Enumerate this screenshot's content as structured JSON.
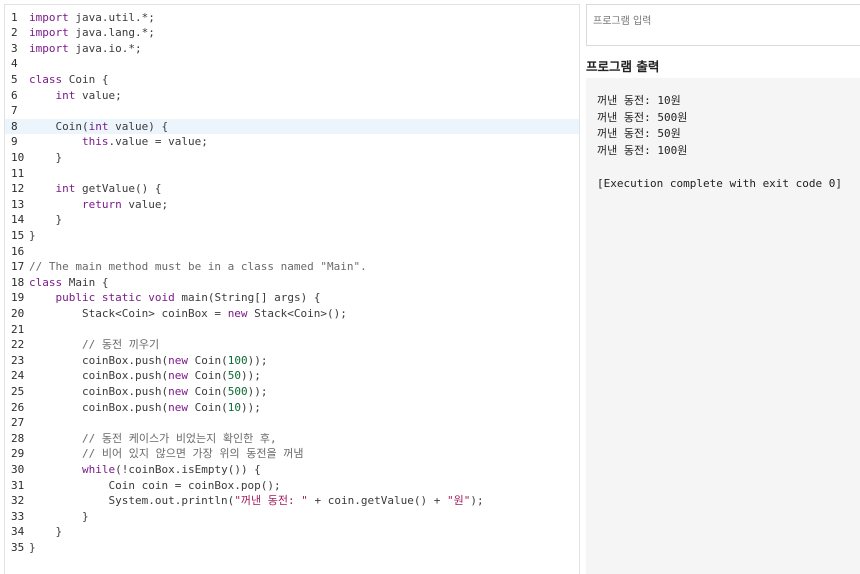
{
  "editor": {
    "active_line": 8,
    "lines": [
      [
        [
          "kw",
          "import"
        ],
        [
          "t",
          " java.util.*;"
        ]
      ],
      [
        [
          "kw",
          "import"
        ],
        [
          "t",
          " java.lang.*;"
        ]
      ],
      [
        [
          "kw",
          "import"
        ],
        [
          "t",
          " java.io.*;"
        ]
      ],
      [],
      [
        [
          "kw",
          "class"
        ],
        [
          "t",
          " Coin {"
        ]
      ],
      [
        [
          "t",
          "    "
        ],
        [
          "ty",
          "int"
        ],
        [
          "t",
          " value;"
        ]
      ],
      [],
      [
        [
          "t",
          "    Coin("
        ],
        [
          "ty",
          "int"
        ],
        [
          "t",
          " value) {"
        ]
      ],
      [
        [
          "t",
          "        "
        ],
        [
          "kw",
          "this"
        ],
        [
          "t",
          ".value = value;"
        ]
      ],
      [
        [
          "t",
          "    }"
        ]
      ],
      [],
      [
        [
          "t",
          "    "
        ],
        [
          "ty",
          "int"
        ],
        [
          "t",
          " getValue() {"
        ]
      ],
      [
        [
          "t",
          "        "
        ],
        [
          "kw",
          "return"
        ],
        [
          "t",
          " value;"
        ]
      ],
      [
        [
          "t",
          "    }"
        ]
      ],
      [
        [
          "t",
          "}"
        ]
      ],
      [],
      [
        [
          "cmt",
          "// The main method must be in a class named \"Main\"."
        ]
      ],
      [
        [
          "kw",
          "class"
        ],
        [
          "t",
          " Main {"
        ]
      ],
      [
        [
          "t",
          "    "
        ],
        [
          "kw",
          "public"
        ],
        [
          "t",
          " "
        ],
        [
          "kw",
          "static"
        ],
        [
          "t",
          " "
        ],
        [
          "ty",
          "void"
        ],
        [
          "t",
          " main(String[] args) {"
        ]
      ],
      [
        [
          "t",
          "        Stack<Coin> coinBox = "
        ],
        [
          "kw",
          "new"
        ],
        [
          "t",
          " Stack<Coin>();"
        ]
      ],
      [],
      [
        [
          "t",
          "        "
        ],
        [
          "cmt",
          "// 동전 끼우기"
        ]
      ],
      [
        [
          "t",
          "        coinBox.push("
        ],
        [
          "kw",
          "new"
        ],
        [
          "t",
          " Coin("
        ],
        [
          "lit",
          "100"
        ],
        [
          "t",
          "));"
        ]
      ],
      [
        [
          "t",
          "        coinBox.push("
        ],
        [
          "kw",
          "new"
        ],
        [
          "t",
          " Coin("
        ],
        [
          "lit",
          "50"
        ],
        [
          "t",
          "));"
        ]
      ],
      [
        [
          "t",
          "        coinBox.push("
        ],
        [
          "kw",
          "new"
        ],
        [
          "t",
          " Coin("
        ],
        [
          "lit",
          "500"
        ],
        [
          "t",
          "));"
        ]
      ],
      [
        [
          "t",
          "        coinBox.push("
        ],
        [
          "kw",
          "new"
        ],
        [
          "t",
          " Coin("
        ],
        [
          "lit",
          "10"
        ],
        [
          "t",
          "));"
        ]
      ],
      [],
      [
        [
          "t",
          "        "
        ],
        [
          "cmt",
          "// 동전 케이스가 비었는지 확인한 후,"
        ]
      ],
      [
        [
          "t",
          "        "
        ],
        [
          "cmt",
          "// 비어 있지 않으면 가장 위의 동전을 꺼냄"
        ]
      ],
      [
        [
          "t",
          "        "
        ],
        [
          "kw",
          "while"
        ],
        [
          "t",
          "(!coinBox.isEmpty()) {"
        ]
      ],
      [
        [
          "t",
          "            Coin coin = coinBox.pop();"
        ]
      ],
      [
        [
          "t",
          "            System.out.println("
        ],
        [
          "str",
          "\"꺼낸 동전: \""
        ],
        [
          "t",
          " + coin.getValue() + "
        ],
        [
          "str",
          "\"원\""
        ],
        [
          "t",
          ");"
        ]
      ],
      [
        [
          "t",
          "        }"
        ]
      ],
      [
        [
          "t",
          "    }"
        ]
      ],
      [
        [
          "t",
          "}"
        ]
      ]
    ]
  },
  "input": {
    "placeholder": "프로그램 입력"
  },
  "output": {
    "title": "프로그램 출력",
    "lines": [
      "꺼낸 동전: 10원",
      "꺼낸 동전: 500원",
      "꺼낸 동전: 50원",
      "꺼낸 동전: 100원",
      "",
      "[Execution complete with exit code 0]"
    ]
  },
  "colors": {
    "keyword": "#7a1b8a",
    "number": "#0b6b33",
    "string": "#a11d5e",
    "comment": "#6a6a6a",
    "active_line_bg": "#ecf5fc",
    "output_bg": "#f5f5f5"
  }
}
